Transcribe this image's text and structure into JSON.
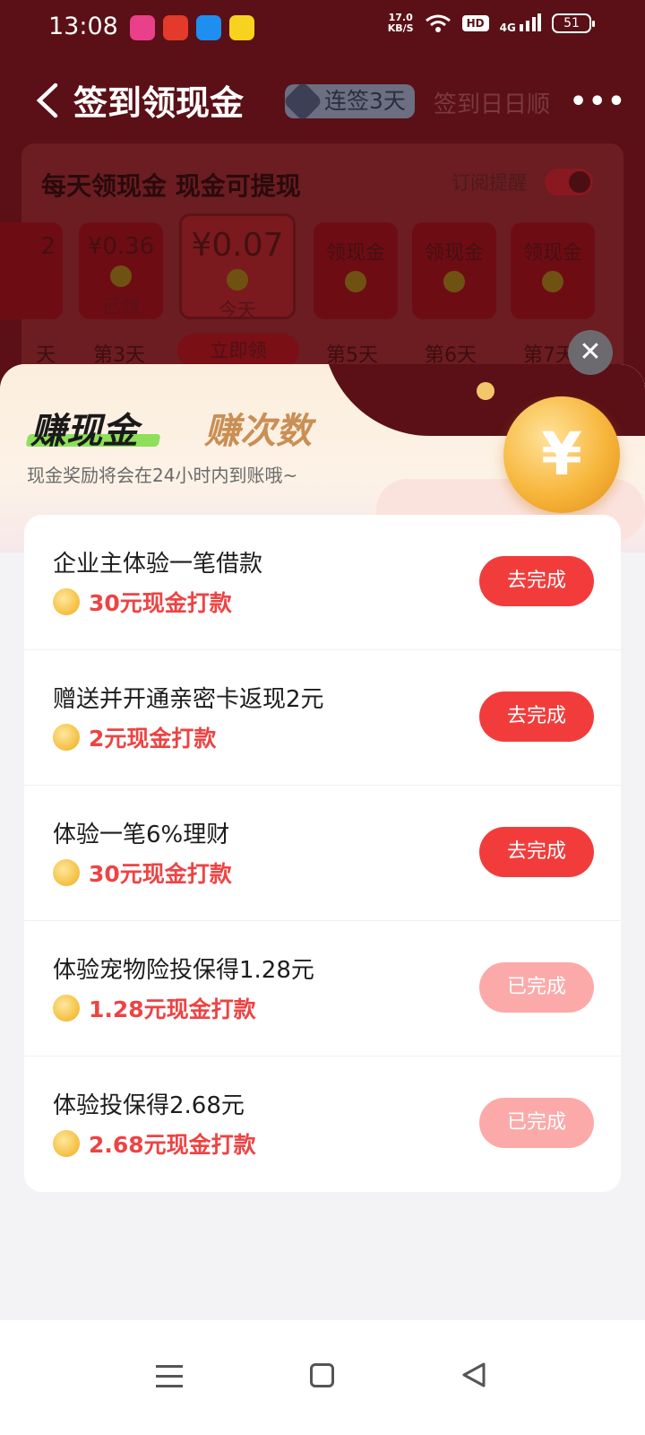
{
  "status_bar": {
    "time": "13:08",
    "net_speed": "17.0",
    "net_unit": "KB/S",
    "hd": "HD",
    "signal": "4G",
    "battery": "51",
    "app_icon_colors": [
      "#ea3f8a",
      "#e33a2c",
      "#1e8ff0",
      "#f7d21e"
    ]
  },
  "header": {
    "title": "签到领现金",
    "streak_label": "连签3天",
    "slogan": "签到日日顺",
    "more": "•••"
  },
  "checkin_card": {
    "title": "每天领现金 现金可提现",
    "subscribe_label": "订阅提醒",
    "envelopes": [
      {
        "amount": "2",
        "label": ""
      },
      {
        "amount": "¥0.36",
        "label": "已领"
      },
      {
        "amount": "¥0.07",
        "label": "今天"
      },
      {
        "amount": "领现金",
        "label": ""
      },
      {
        "amount": "领现金",
        "label": ""
      },
      {
        "amount": "领现金",
        "label": ""
      }
    ],
    "days": [
      "天",
      "第3天",
      "第5天",
      "第6天",
      "第7天"
    ],
    "claim_label": "立即领"
  },
  "sheet": {
    "tab_active": "赚现金",
    "tab_inactive": "赚次数",
    "hint": "现金奖励将会在24小时内到账哦~",
    "tasks": [
      {
        "title": "企业主体验一笔借款",
        "reward": "30元现金打款",
        "button": "去完成",
        "done": false
      },
      {
        "title": "赠送并开通亲密卡返现2元",
        "reward": "2元现金打款",
        "button": "去完成",
        "done": false
      },
      {
        "title": "体验一笔6%理财",
        "reward": "30元现金打款",
        "button": "去完成",
        "done": false
      },
      {
        "title": "体验宠物险投保得1.28元",
        "reward": "1.28元现金打款",
        "button": "已完成",
        "done": true
      },
      {
        "title": "体验投保得2.68元",
        "reward": "2.68元现金打款",
        "button": "已完成",
        "done": true
      }
    ],
    "big_coin_symbol": "¥",
    "close_symbol": "✕"
  },
  "colors": {
    "accent_red": "#f23c3c",
    "reward_red": "#ee4343",
    "done_pink": "#fbaaa9",
    "tab_green": "#8ee05a",
    "tab_gold": "#c98f55"
  }
}
